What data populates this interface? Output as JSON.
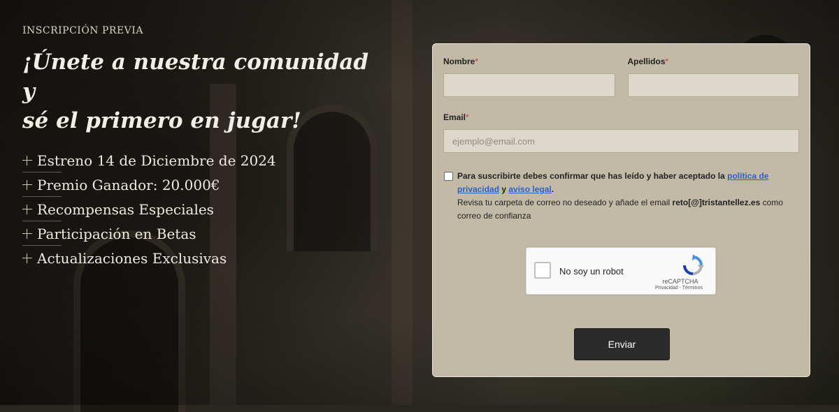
{
  "hero": {
    "eyebrow": "INSCRIPCIÓN PREVIA",
    "headline_line1": "¡Únete a nuestra comunidad y",
    "headline_line2": "sé el primero en jugar!",
    "features": [
      "Estreno 14 de Diciembre de 2024",
      "Premio Ganador: 20.000€",
      "Recompensas Especiales",
      "Participación en Betas",
      "Actualizaciones Exclusivas"
    ],
    "feature_icon": "plus-icon"
  },
  "form": {
    "first_name": {
      "label": "Nombre",
      "required_mark": "*",
      "value": ""
    },
    "last_name": {
      "label": "Apellidos",
      "required_mark": "*",
      "value": ""
    },
    "email": {
      "label": "Email",
      "required_mark": "*",
      "placeholder": "ejemplo@email.com",
      "value": ""
    },
    "consent": {
      "checked": false,
      "text_before": "Para suscribirte debes confirmar que has leído y haber aceptado la ",
      "privacy_link": "política de privacidad",
      "text_and": " y ",
      "legal_link": "aviso legal",
      "text_end": ".",
      "note_before": "Revisa tu carpeta de correo no deseado y añade el email ",
      "note_email": "reto[@]tristantellez.es",
      "note_after": " como correo de confianza"
    },
    "captcha": {
      "label": "No soy un robot",
      "brand": "reCAPTCHA",
      "links": "Privacidad - Términos",
      "icon": "recaptcha-icon"
    },
    "submit_label": "Enviar"
  },
  "colors": {
    "form_bg": "#c2baa6",
    "input_bg": "#ded8cb",
    "button_bg": "#2b2b2b",
    "link": "#2d5fc8",
    "required": "#c0392b"
  }
}
